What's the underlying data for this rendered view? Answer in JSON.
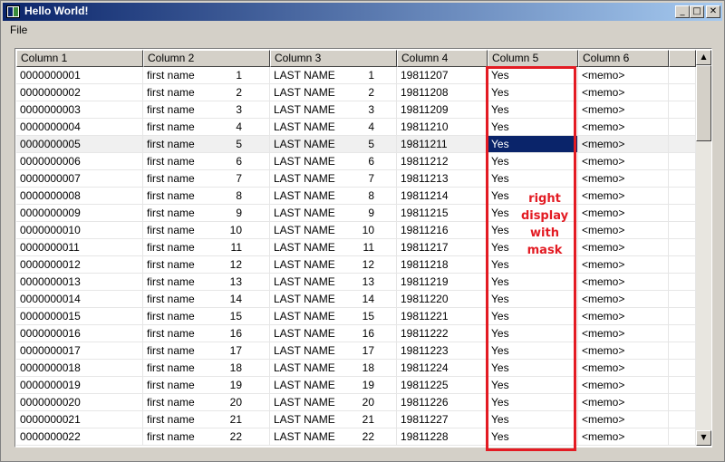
{
  "window": {
    "title": "Hello World!",
    "min": "_",
    "max": "□",
    "close": "✕"
  },
  "menu": {
    "file": "File"
  },
  "columns": [
    "Column 1",
    "Column 2",
    "Column 3",
    "Column 4",
    "Column 5",
    "Column 6"
  ],
  "rows": [
    {
      "c1": "0000000001",
      "c2": "first name",
      "n2": "1",
      "c3": "LAST NAME",
      "n3": "1",
      "c4": "19811207",
      "c5": "Yes",
      "c6": "<memo>"
    },
    {
      "c1": "0000000002",
      "c2": "first name",
      "n2": "2",
      "c3": "LAST NAME",
      "n3": "2",
      "c4": "19811208",
      "c5": "Yes",
      "c6": "<memo>"
    },
    {
      "c1": "0000000003",
      "c2": "first name",
      "n2": "3",
      "c3": "LAST NAME",
      "n3": "3",
      "c4": "19811209",
      "c5": "Yes",
      "c6": "<memo>"
    },
    {
      "c1": "0000000004",
      "c2": "first name",
      "n2": "4",
      "c3": "LAST NAME",
      "n3": "4",
      "c4": "19811210",
      "c5": "Yes",
      "c6": "<memo>"
    },
    {
      "c1": "0000000005",
      "c2": "first name",
      "n2": "5",
      "c3": "LAST NAME",
      "n3": "5",
      "c4": "19811211",
      "c5": "Yes",
      "c6": "<memo>"
    },
    {
      "c1": "0000000006",
      "c2": "first name",
      "n2": "6",
      "c3": "LAST NAME",
      "n3": "6",
      "c4": "19811212",
      "c5": "Yes",
      "c6": "<memo>"
    },
    {
      "c1": "0000000007",
      "c2": "first name",
      "n2": "7",
      "c3": "LAST NAME",
      "n3": "7",
      "c4": "19811213",
      "c5": "Yes",
      "c6": "<memo>"
    },
    {
      "c1": "0000000008",
      "c2": "first name",
      "n2": "8",
      "c3": "LAST NAME",
      "n3": "8",
      "c4": "19811214",
      "c5": "Yes",
      "c6": "<memo>"
    },
    {
      "c1": "0000000009",
      "c2": "first name",
      "n2": "9",
      "c3": "LAST NAME",
      "n3": "9",
      "c4": "19811215",
      "c5": "Yes",
      "c6": "<memo>"
    },
    {
      "c1": "0000000010",
      "c2": "first name",
      "n2": "10",
      "c3": "LAST NAME",
      "n3": "10",
      "c4": "19811216",
      "c5": "Yes",
      "c6": "<memo>"
    },
    {
      "c1": "0000000011",
      "c2": "first name",
      "n2": "11",
      "c3": "LAST NAME",
      "n3": "11",
      "c4": "19811217",
      "c5": "Yes",
      "c6": "<memo>"
    },
    {
      "c1": "0000000012",
      "c2": "first name",
      "n2": "12",
      "c3": "LAST NAME",
      "n3": "12",
      "c4": "19811218",
      "c5": "Yes",
      "c6": "<memo>"
    },
    {
      "c1": "0000000013",
      "c2": "first name",
      "n2": "13",
      "c3": "LAST NAME",
      "n3": "13",
      "c4": "19811219",
      "c5": "Yes",
      "c6": "<memo>"
    },
    {
      "c1": "0000000014",
      "c2": "first name",
      "n2": "14",
      "c3": "LAST NAME",
      "n3": "14",
      "c4": "19811220",
      "c5": "Yes",
      "c6": "<memo>"
    },
    {
      "c1": "0000000015",
      "c2": "first name",
      "n2": "15",
      "c3": "LAST NAME",
      "n3": "15",
      "c4": "19811221",
      "c5": "Yes",
      "c6": "<memo>"
    },
    {
      "c1": "0000000016",
      "c2": "first name",
      "n2": "16",
      "c3": "LAST NAME",
      "n3": "16",
      "c4": "19811222",
      "c5": "Yes",
      "c6": "<memo>"
    },
    {
      "c1": "0000000017",
      "c2": "first name",
      "n2": "17",
      "c3": "LAST NAME",
      "n3": "17",
      "c4": "19811223",
      "c5": "Yes",
      "c6": "<memo>"
    },
    {
      "c1": "0000000018",
      "c2": "first name",
      "n2": "18",
      "c3": "LAST NAME",
      "n3": "18",
      "c4": "19811224",
      "c5": "Yes",
      "c6": "<memo>"
    },
    {
      "c1": "0000000019",
      "c2": "first name",
      "n2": "19",
      "c3": "LAST NAME",
      "n3": "19",
      "c4": "19811225",
      "c5": "Yes",
      "c6": "<memo>"
    },
    {
      "c1": "0000000020",
      "c2": "first name",
      "n2": "20",
      "c3": "LAST NAME",
      "n3": "20",
      "c4": "19811226",
      "c5": "Yes",
      "c6": "<memo>"
    },
    {
      "c1": "0000000021",
      "c2": "first name",
      "n2": "21",
      "c3": "LAST NAME",
      "n3": "21",
      "c4": "19811227",
      "c5": "Yes",
      "c6": "<memo>"
    },
    {
      "c1": "0000000022",
      "c2": "first name",
      "n2": "22",
      "c3": "LAST NAME",
      "n3": "22",
      "c4": "19811228",
      "c5": "Yes",
      "c6": "<memo>"
    }
  ],
  "selected_row": 4,
  "annotation": {
    "lines": [
      "right",
      "display",
      "with",
      "mask"
    ],
    "color": "#e31b23"
  },
  "colors": {
    "titlebar_start": "#0a246a",
    "titlebar_end": "#a6caf0",
    "selection": "#0a246a",
    "annotation": "#e31b23"
  }
}
